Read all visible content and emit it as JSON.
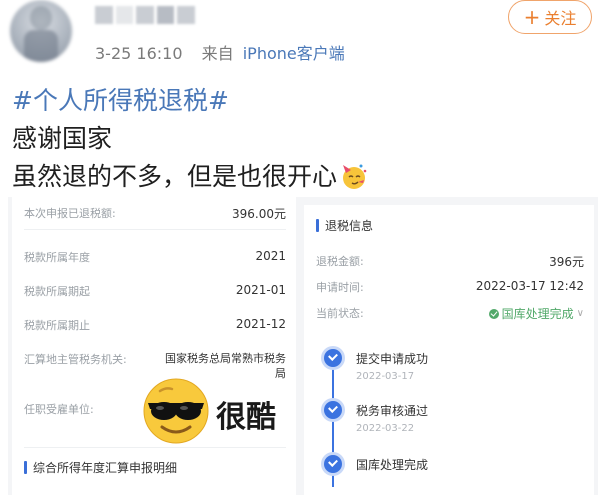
{
  "post": {
    "timestamp": "3-25 16:10",
    "source_prefix": "来自",
    "source_client": "iPhone客户端",
    "follow_label": "关注",
    "hashtag": "#个人所得税退税#",
    "line1": "感谢国家",
    "line2": "虽然退的不多，但是也很开心"
  },
  "left_panel": {
    "rows": [
      {
        "label": "本次申报已退税额:",
        "value": "396.00元"
      },
      {
        "label": "税款所属年度",
        "value": "2021"
      },
      {
        "label": "税款所属期起",
        "value": "2021-01"
      },
      {
        "label": "税款所属期止",
        "value": "2021-12"
      },
      {
        "label": "汇算地主管税务机关:",
        "value": "国家税务总局常熟市税务局"
      },
      {
        "label": "任职受雇单位:",
        "value": ""
      }
    ],
    "section_title": "综合所得年度汇算申报明细"
  },
  "right_panel": {
    "section_title": "退税信息",
    "rows": [
      {
        "label": "退税金额:",
        "value": "396元"
      },
      {
        "label": "申请时间:",
        "value": "2022-03-17 12:42"
      },
      {
        "label": "当前状态:",
        "value": "国库处理完成"
      }
    ],
    "timeline": [
      {
        "label": "提交申请成功",
        "date": "2022-03-17"
      },
      {
        "label": "税务审核通过",
        "date": "2022-03-22"
      },
      {
        "label": "国库处理完成",
        "date": ""
      }
    ]
  },
  "overlay": {
    "text": "很酷"
  },
  "colors": {
    "link": "#4a78b8",
    "follow": "#ea7f2f",
    "accent": "#3b73e0",
    "status_green": "#52a96a"
  }
}
